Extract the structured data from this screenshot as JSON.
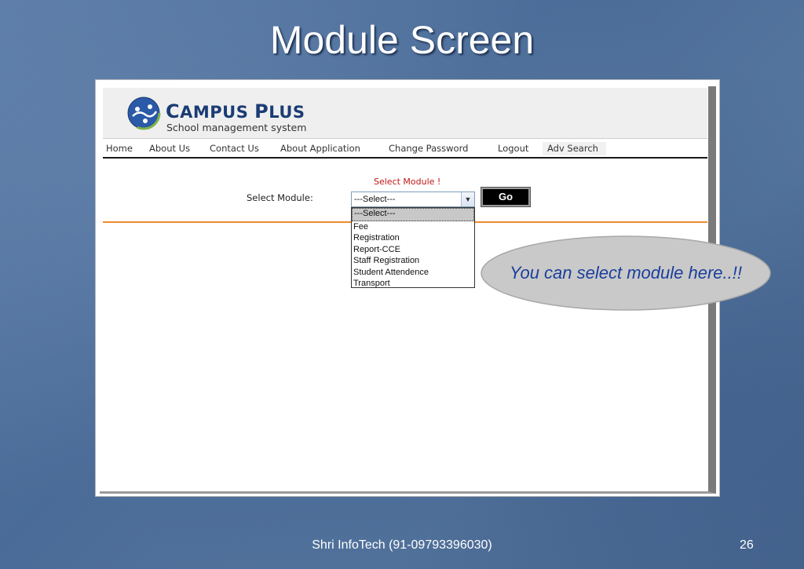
{
  "slide": {
    "title": "Module Screen",
    "footer": "Shri InfoTech (91-09793396030)",
    "page_number": "26"
  },
  "app": {
    "brand_prefix_C": "C",
    "brand_rest1": "AMPUS ",
    "brand_prefix_P": "P",
    "brand_rest2": "LUS",
    "tagline": "School management system",
    "logo_icon": "globe-icon"
  },
  "nav": {
    "items": [
      "Home",
      "About Us",
      "Contact Us",
      "About Application",
      "Change Password",
      "Logout",
      "Adv Search"
    ]
  },
  "form": {
    "heading": "Select Module !",
    "label": "Select Module:",
    "selected_value": "---Select---",
    "go_label": "Go",
    "options": [
      "---Select---",
      "Fee",
      "Registration",
      "Report-CCE",
      "Staff Registration",
      "Student Attendence",
      "Transport"
    ]
  },
  "callout": {
    "text": "You can select module here..!!"
  },
  "colors": {
    "brand": "#1b3c74",
    "accent_red": "#c01818",
    "orange_rule": "#f08a2a",
    "callout_text": "#1a3f9c"
  }
}
